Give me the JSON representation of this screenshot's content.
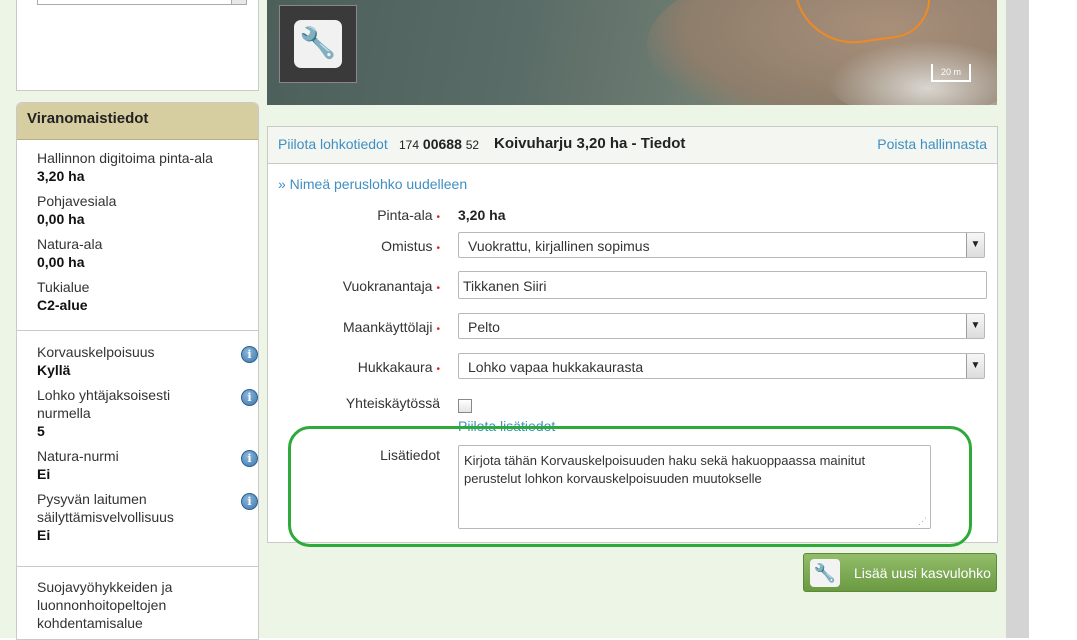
{
  "sidebar": {
    "authority": {
      "title": "Viranomaistiedot",
      "items": [
        {
          "label": "Hallinnon digitoima pinta-ala",
          "value": "3,20 ha"
        },
        {
          "label": "Pohjavesiala",
          "value": "0,00 ha"
        },
        {
          "label": "Natura-ala",
          "value": "0,00 ha"
        },
        {
          "label": "Tukialue",
          "value": "C2-alue"
        }
      ],
      "info_items": [
        {
          "label": "Korvauskelpoisuus",
          "value": "Kyllä",
          "icon": "info-icon"
        },
        {
          "label": "Lohko yhtäjaksoisesti nurmella",
          "value": "5",
          "icon": "info-icon"
        },
        {
          "label": "Natura-nurmi",
          "value": "Ei",
          "icon": "info-icon"
        },
        {
          "label": "Pysyvän laitumen säilyttämisvelvollisuus",
          "value": "Ei",
          "icon": "info-icon"
        }
      ],
      "bottom_label": "Suojavyöhykkeiden ja luonnonhoitopeltojen kohdentamisalue"
    }
  },
  "map": {
    "scale_label": "20 m",
    "tool_icon": "wrench-icon"
  },
  "panel": {
    "hide_link": "Piilota lohkotiedot",
    "id_prefix": "174",
    "id_main": "00688",
    "id_suffix": "52",
    "title": "Koivuharju 3,20 ha - Tiedot",
    "remove_link": "Poista hallinnasta",
    "rename_link": "» Nimeä peruslohko uudelleen",
    "fields": {
      "area_label": "Pinta-ala",
      "area_value": "3,20 ha",
      "ownership_label": "Omistus",
      "ownership_value": "Vuokrattu, kirjallinen sopimus",
      "lessor_label": "Vuokranantaja",
      "lessor_value": "Tikkanen Siiri",
      "landuse_label": "Maankäyttölaji",
      "landuse_value": "Pelto",
      "oat_label": "Hukkakaura",
      "oat_value": "Lohko vapaa hukkakaurasta",
      "shared_label": "Yhteiskäytössä",
      "hide_extra_link": "Piilota lisätiedot",
      "extra_label": "Lisätiedot",
      "extra_value": "Kirjota tähän Korvauskelpoisuuden haku sekä hakuoppaassa mainitut perustelut lohkon korvauskelpoisuuden muutokselle"
    },
    "required_mark": "•"
  },
  "add_button": {
    "label": "Lisää uusi kasvulohko",
    "icon": "wrench-icon"
  },
  "colors": {
    "link": "#3f8fc2",
    "header_band": "#d6cda0",
    "button_green": "#6a9a42",
    "highlight": "#2eaa3a",
    "required": "#dd2222"
  }
}
